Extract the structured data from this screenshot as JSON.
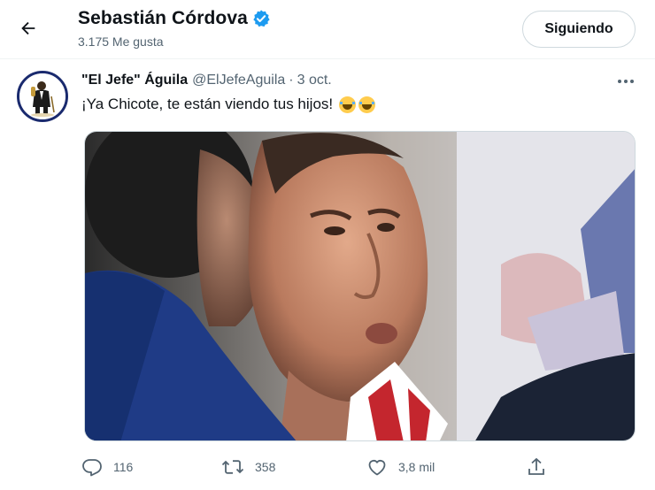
{
  "header": {
    "name": "Sebastián Córdova",
    "subtitle": "3.175 Me gusta",
    "follow_label": "Siguiendo"
  },
  "tweet": {
    "author_name": "\"El Jefe\" Águila",
    "author_handle": "@ElJefeAguila",
    "separator": "·",
    "date": "3 oct.",
    "text": "¡Ya Chicote, te están viendo tus hijos!",
    "emojis": [
      "face-with-tears-of-joy",
      "face-with-tears-of-joy"
    ]
  },
  "actions": {
    "replies": "116",
    "retweets": "358",
    "likes": "3,8 mil"
  },
  "colors": {
    "verified": "#1d9bf0",
    "secondary_text": "#536471",
    "border": "#cfd9de"
  },
  "icons": {
    "back": "arrow-left-icon",
    "verified": "verified-badge-icon",
    "more": "more-icon",
    "reply": "reply-icon",
    "retweet": "retweet-icon",
    "like": "heart-icon",
    "share": "share-icon"
  }
}
